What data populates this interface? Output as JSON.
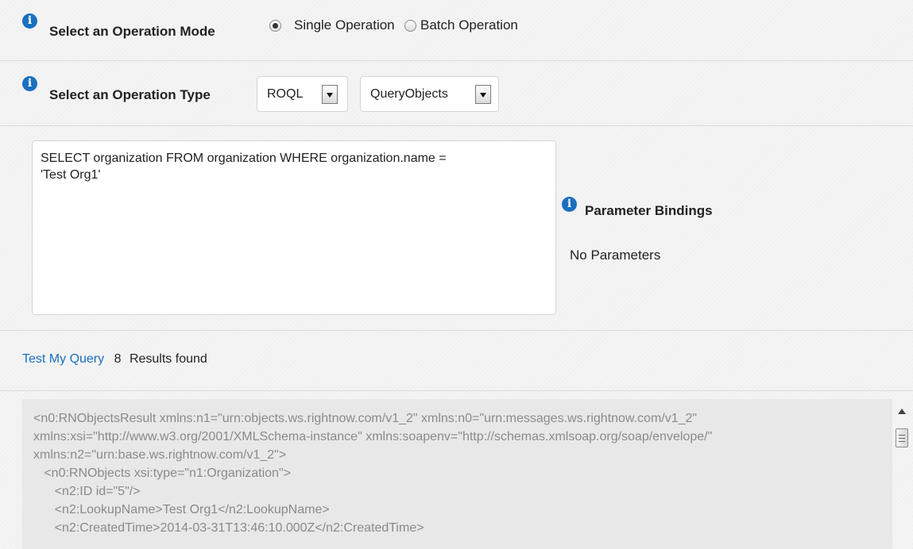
{
  "operation_mode": {
    "label": "Select an Operation Mode",
    "options": [
      {
        "label": "Single Operation",
        "selected": true
      },
      {
        "label": "Batch Operation",
        "selected": false
      }
    ]
  },
  "operation_type": {
    "label": "Select an Operation Type",
    "language_select": "ROQL",
    "operation_select": "QueryObjects"
  },
  "query": {
    "text": "SELECT organization FROM organization WHERE organization.name =\n'Test Org1'"
  },
  "parameters": {
    "heading": "Parameter Bindings",
    "empty_text": "No Parameters"
  },
  "test": {
    "link_label": "Test My Query",
    "count": "8",
    "results_label": "Results found"
  },
  "result_lines": [
    "<n0:RNObjectsResult xmlns:n1=\"urn:objects.ws.rightnow.com/v1_2\" xmlns:n0=\"urn:messages.ws.rightnow.com/v1_2\"",
    "xmlns:xsi=\"http://www.w3.org/2001/XMLSchema-instance\" xmlns:soapenv=\"http://schemas.xmlsoap.org/soap/envelope/\"",
    "xmlns:n2=\"urn:base.ws.rightnow.com/v1_2\">",
    "   <n0:RNObjects xsi:type=\"n1:Organization\">",
    "      <n2:ID id=\"5\"/>",
    "      <n2:LookupName>Test Org1</n2:LookupName>",
    "      <n2:CreatedTime>2014-03-31T13:46:10.000Z</n2:CreatedTime>"
  ],
  "colors": {
    "info_icon": "#1a6fc0",
    "link": "#1a6fc0",
    "result_text": "#8a8a8a",
    "result_bg": "#e8e8e8"
  }
}
